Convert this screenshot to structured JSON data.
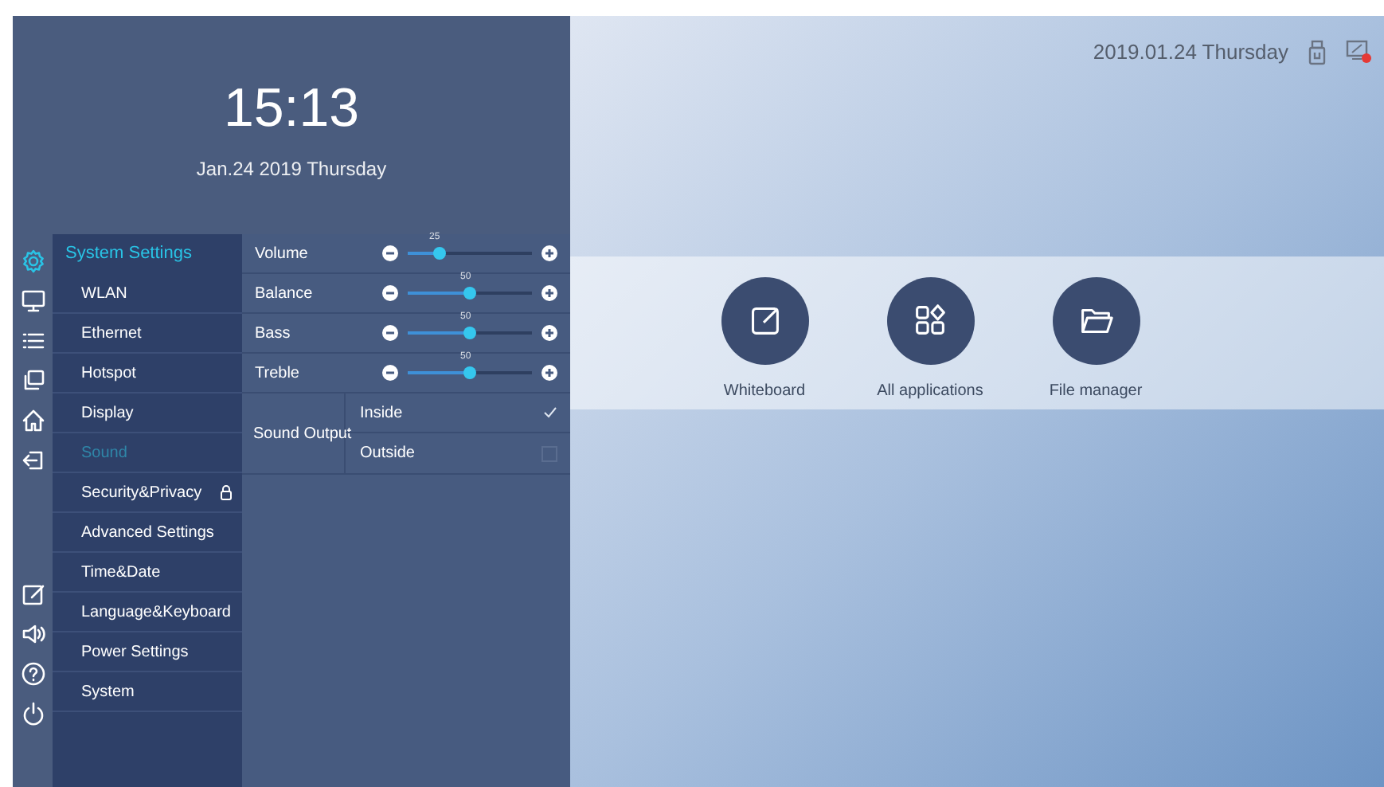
{
  "clock": {
    "time": "15:13",
    "date": "Jan.24 2019 Thursday"
  },
  "rail": {
    "top": [
      {
        "kind": "gear",
        "selected": true
      },
      {
        "kind": "monitor",
        "selected": false
      },
      {
        "kind": "list",
        "selected": false
      },
      {
        "kind": "windows",
        "selected": false
      },
      {
        "kind": "home",
        "selected": false
      },
      {
        "kind": "exit",
        "selected": false
      }
    ],
    "bottom": [
      {
        "kind": "edit",
        "selected": false
      },
      {
        "kind": "speaker",
        "selected": false
      },
      {
        "kind": "help",
        "selected": false
      },
      {
        "kind": "power",
        "selected": false
      }
    ]
  },
  "menu": {
    "title": "System Settings",
    "items": [
      {
        "label": "WLAN",
        "selected": false,
        "locked": false
      },
      {
        "label": "Ethernet",
        "selected": false,
        "locked": false
      },
      {
        "label": "Hotspot",
        "selected": false,
        "locked": false
      },
      {
        "label": "Display",
        "selected": false,
        "locked": false
      },
      {
        "label": "Sound",
        "selected": true,
        "locked": false
      },
      {
        "label": "Security&Privacy",
        "selected": false,
        "locked": true
      },
      {
        "label": "Advanced Settings",
        "selected": false,
        "locked": false
      },
      {
        "label": "Time&Date",
        "selected": false,
        "locked": false
      },
      {
        "label": "Language&Keyboard",
        "selected": false,
        "locked": false
      },
      {
        "label": "Power Settings",
        "selected": false,
        "locked": false
      },
      {
        "label": "System",
        "selected": false,
        "locked": false
      }
    ]
  },
  "sound": {
    "sliders": [
      {
        "label": "Volume",
        "reading": "25",
        "level": 0.25
      },
      {
        "label": "Balance",
        "reading": "50",
        "level": 0.5
      },
      {
        "label": "Bass",
        "reading": "50",
        "level": 0.5
      },
      {
        "label": "Treble",
        "reading": "50",
        "level": 0.5
      }
    ],
    "output": {
      "label": "Sound Output",
      "options": [
        {
          "label": "Inside",
          "checked": true
        },
        {
          "label": "Outside",
          "checked": false
        }
      ]
    }
  },
  "status": {
    "date": "2019.01.24 Thursday"
  },
  "apps": [
    {
      "kind": "whiteboard",
      "label": "Whiteboard"
    },
    {
      "kind": "apps",
      "label": "All applications"
    },
    {
      "kind": "folder",
      "label": "File manager"
    }
  ]
}
